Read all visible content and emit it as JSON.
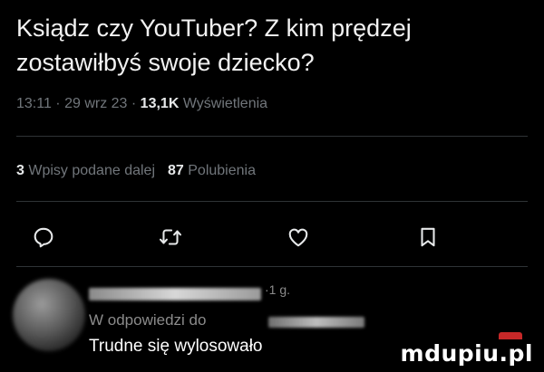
{
  "tweet": {
    "text": "Ksiądz czy YouTuber? Z kim prędzej zostawiłbyś swoje dziecko?"
  },
  "meta": {
    "time": "13:11",
    "separator1": " · ",
    "date": "29 wrz 23",
    "separator2": " · ",
    "views_count": "13,1K",
    "views_label": " Wyświetlenia"
  },
  "stats": {
    "quotes_count": "3",
    "quotes_label": " Wpisy podane dalej",
    "likes_count": "87",
    "likes_label": " Polubienia"
  },
  "actions": {
    "icons": [
      "reply-icon",
      "retweet-icon",
      "like-icon",
      "bookmark-icon"
    ]
  },
  "reply": {
    "handle": "·1 g.",
    "in_reply_to": "W odpowiedzi do",
    "text": "Trudne się wylosowało"
  },
  "watermark": {
    "text": "mdupiu.pl"
  }
}
